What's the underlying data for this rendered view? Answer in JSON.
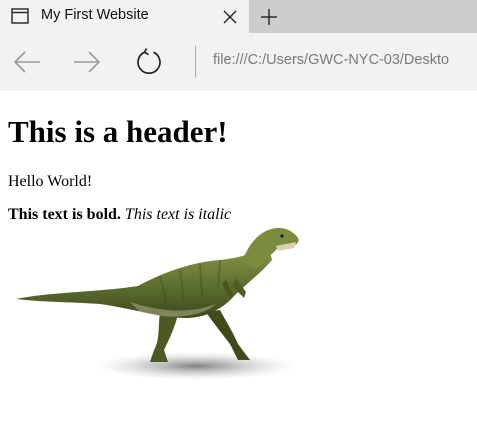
{
  "tab": {
    "title": "My First Website"
  },
  "toolbar": {
    "address": "file:///C:/Users/GWC-NYC-03/Deskto"
  },
  "page": {
    "header": "This is a header!",
    "paragraph": "Hello World!",
    "bold_text": "This text is bold.",
    "italic_text": "This text is italic",
    "image_subject": "dinosaur"
  },
  "icons": {
    "tab": "tab-window-icon",
    "close": "close-icon",
    "new_tab": "plus-icon",
    "back": "back-arrow-icon",
    "forward": "forward-arrow-icon",
    "refresh": "refresh-icon"
  }
}
